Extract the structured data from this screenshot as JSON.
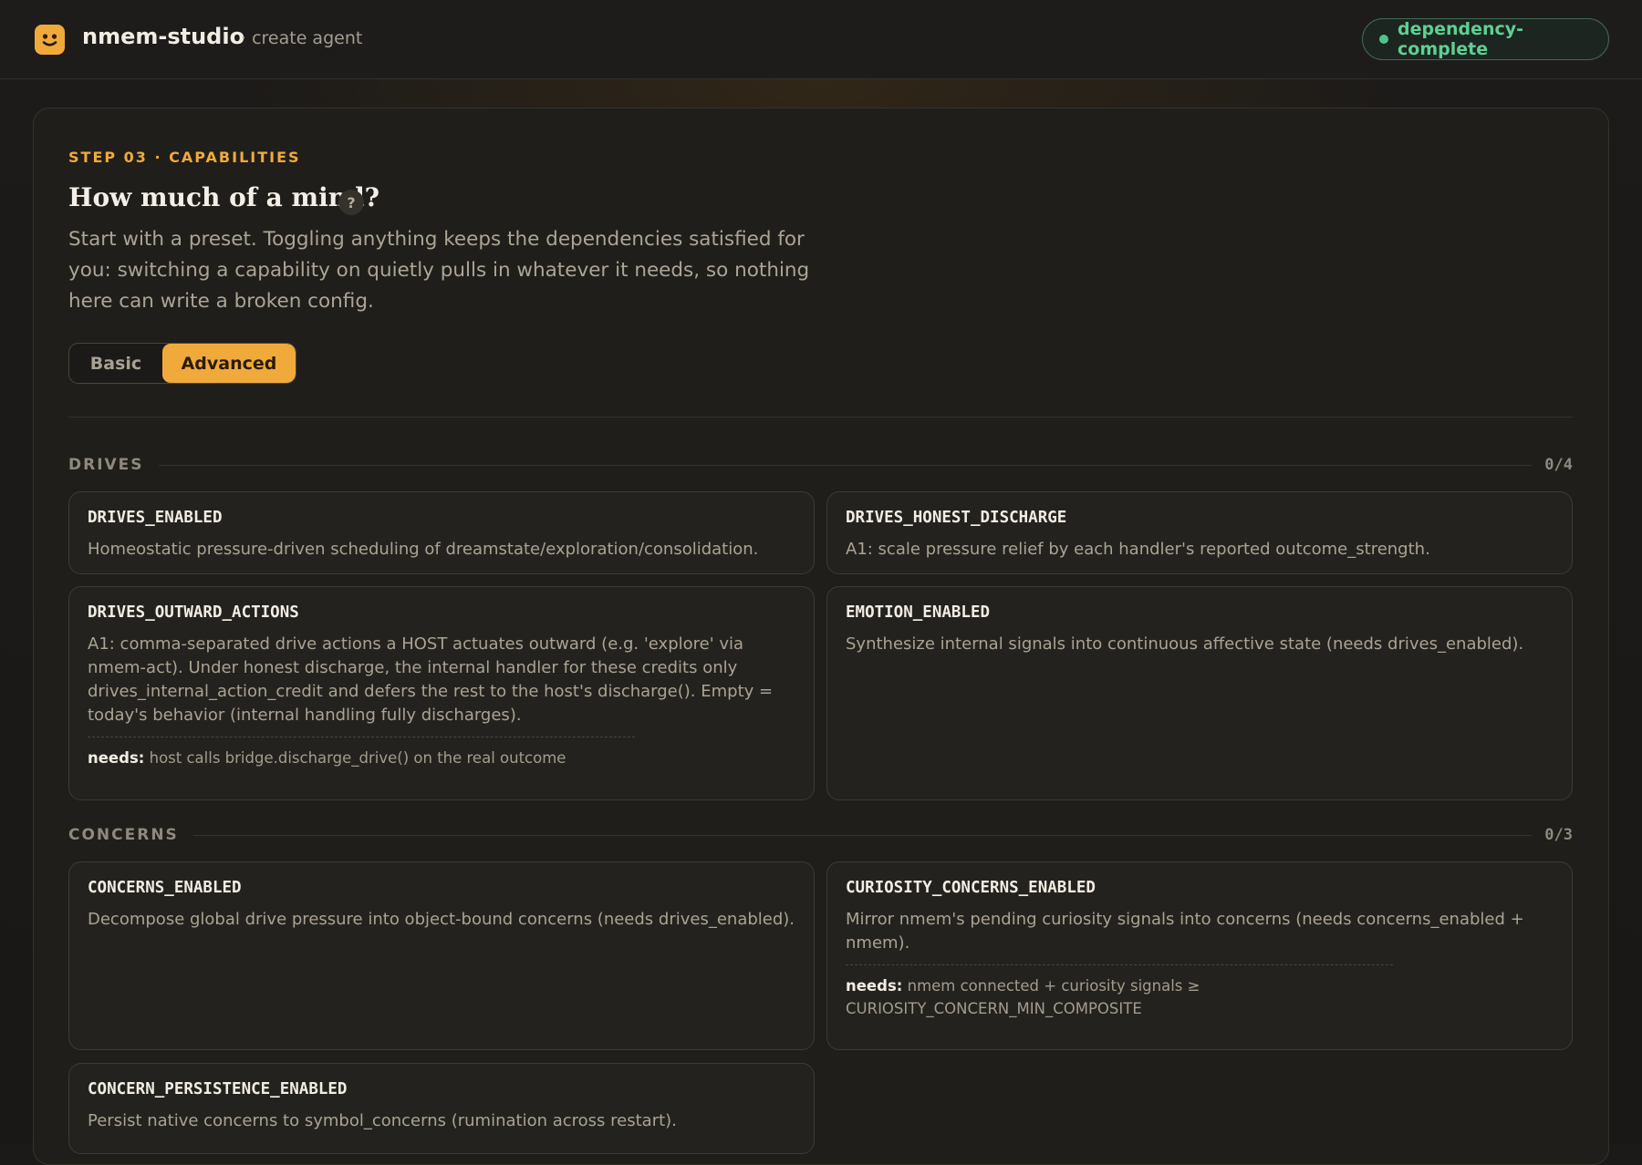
{
  "topbar": {
    "brand": "nmem-studio",
    "crumb": "· create agent",
    "status": "dependency-complete",
    "logo_icon": "smiley-icon"
  },
  "colors": {
    "accent": "#f0aa3c",
    "status_green": "#5fcf93",
    "background": "#1c1a18"
  },
  "step": {
    "label": "STEP 03 · CAPABILITIES",
    "heading": "How much of a mind?",
    "help": "?",
    "intro": "Start with a preset. Toggling anything keeps the dependencies satisfied for you: switching a capability on quietly pulls in whatever it needs, so nothing here can write a broken config."
  },
  "mode": {
    "basic": "Basic",
    "advanced": "Advanced",
    "selected": "Advanced"
  },
  "sections": {
    "drives": {
      "title": "DRIVES",
      "count": "0/4",
      "cards": [
        {
          "key": "DRIVES_ENABLED",
          "desc": "Homeostatic pressure-driven scheduling of dreamstate/exploration/consolidation."
        },
        {
          "key": "DRIVES_HONEST_DISCHARGE",
          "desc": "A1: scale pressure relief by each handler's reported outcome_strength."
        },
        {
          "key": "DRIVES_OUTWARD_ACTIONS",
          "desc": "A1: comma-separated drive actions a HOST actuates outward (e.g. 'explore' via nmem-act). Under honest discharge, the internal handler for these credits only drives_internal_action_credit and defers the rest to the host's discharge(). Empty = today's behavior (internal handling fully discharges).",
          "needs_label": "needs:",
          "needs": "host calls bridge.discharge_drive() on the real outcome"
        },
        {
          "key": "EMOTION_ENABLED",
          "desc": "Synthesize internal signals into continuous affective state (needs drives_enabled)."
        }
      ]
    },
    "concerns": {
      "title": "CONCERNS",
      "count": "0/3",
      "cards": [
        {
          "key": "CONCERNS_ENABLED",
          "desc": "Decompose global drive pressure into object-bound concerns (needs drives_enabled)."
        },
        {
          "key": "CURIOSITY_CONCERNS_ENABLED",
          "desc": "Mirror nmem's pending curiosity signals into concerns (needs concerns_enabled + nmem).",
          "needs_label": "needs:",
          "needs": "nmem connected + curiosity signals ≥ CURIOSITY_CONCERN_MIN_COMPOSITE"
        },
        {
          "key": "CONCERN_PERSISTENCE_ENABLED",
          "desc": "Persist native concerns to symbol_concerns (rumination across restart)."
        }
      ]
    }
  }
}
